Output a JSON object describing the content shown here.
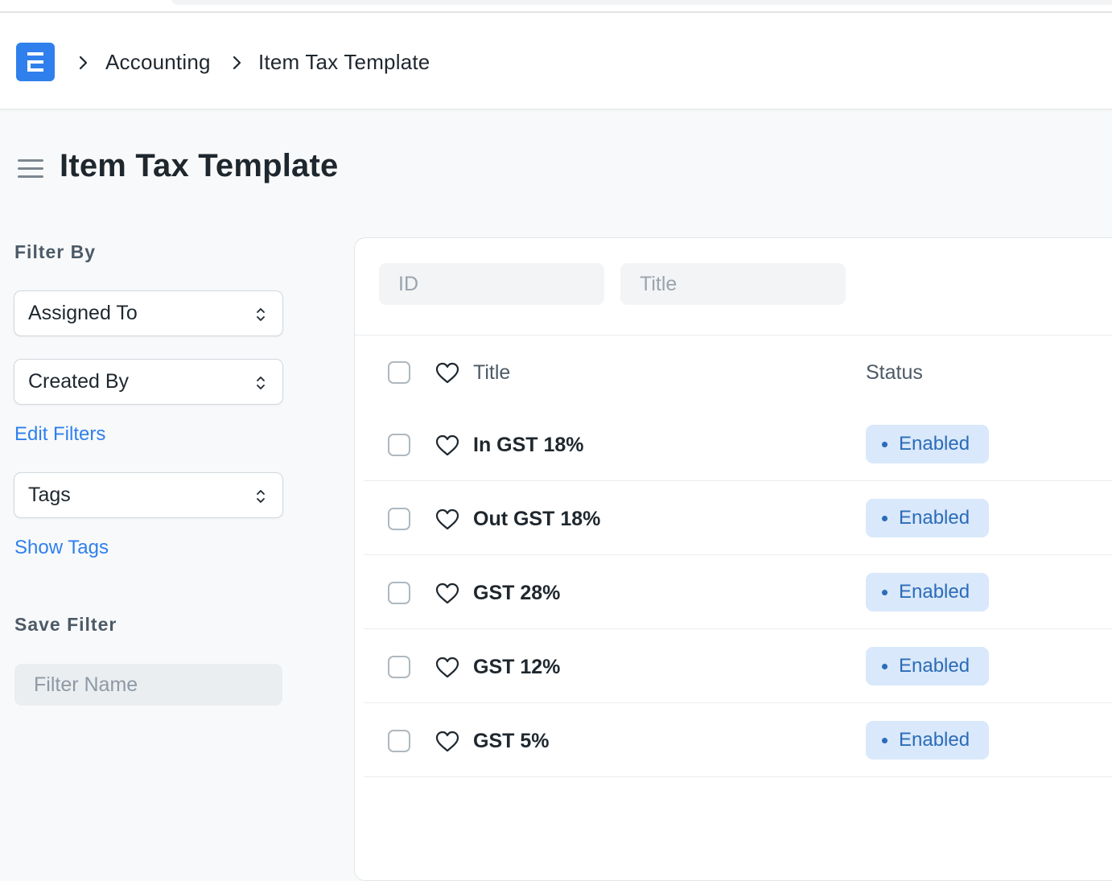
{
  "breadcrumb": {
    "items": [
      "Accounting",
      "Item Tax Template"
    ]
  },
  "page": {
    "title": "Item Tax Template"
  },
  "sidebar": {
    "filter_by_label": "Filter By",
    "assigned_to": "Assigned To",
    "created_by": "Created By",
    "edit_filters": "Edit Filters",
    "tags": "Tags",
    "show_tags": "Show Tags",
    "save_filter_label": "Save Filter",
    "filter_name_placeholder": "Filter Name"
  },
  "list": {
    "filters": {
      "id_placeholder": "ID",
      "title_placeholder": "Title"
    },
    "columns": {
      "title": "Title",
      "status": "Status"
    },
    "rows": [
      {
        "title": "In GST 18%",
        "status": "Enabled"
      },
      {
        "title": "Out GST 18%",
        "status": "Enabled"
      },
      {
        "title": "GST 28%",
        "status": "Enabled"
      },
      {
        "title": "GST 12%",
        "status": "Enabled"
      },
      {
        "title": "GST 5%",
        "status": "Enabled"
      }
    ]
  },
  "colors": {
    "brand": "#2f80ed",
    "status_enabled_bg": "#d9e8fb",
    "status_enabled_text": "#2b6cb8",
    "link": "#2f80ed"
  },
  "icons": [
    "app-logo-icon",
    "chevron-right-icon",
    "hamburger-menu-icon",
    "select-updown-icon",
    "heart-icon",
    "status-dot-icon"
  ]
}
